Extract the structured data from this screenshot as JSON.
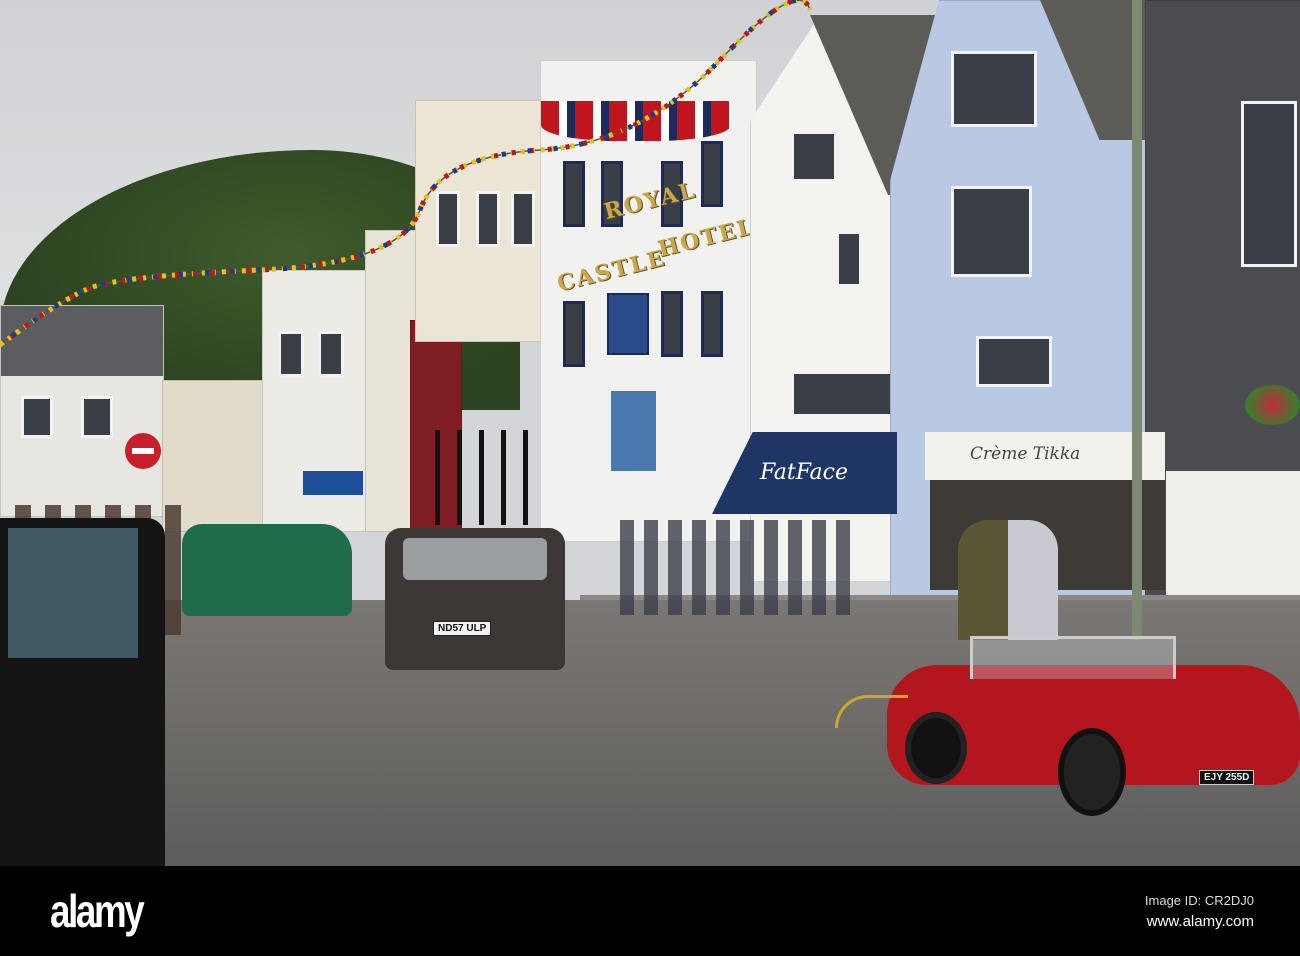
{
  "photo": {
    "description_label": "Street scene",
    "hotel_sign": {
      "line1": "ROYAL",
      "line2": "HOTEL",
      "line3": "CASTLE"
    },
    "shop_awning": "FatFace",
    "shop_sign": "Crème Tikka",
    "plates": {
      "suv": "ND57 ULP",
      "roadster": "EJY 255D"
    },
    "colors": {
      "sky": "#d3d5d8",
      "hill": "#35502a",
      "road": "#6f6c6a",
      "awning": "#1f3566",
      "roadster": "#b3161c",
      "blue_house": "#b9c8e3"
    }
  },
  "footer": {
    "logo": "alamy",
    "image_id": "Image ID: CR2DJ0",
    "url": "www.alamy.com"
  }
}
